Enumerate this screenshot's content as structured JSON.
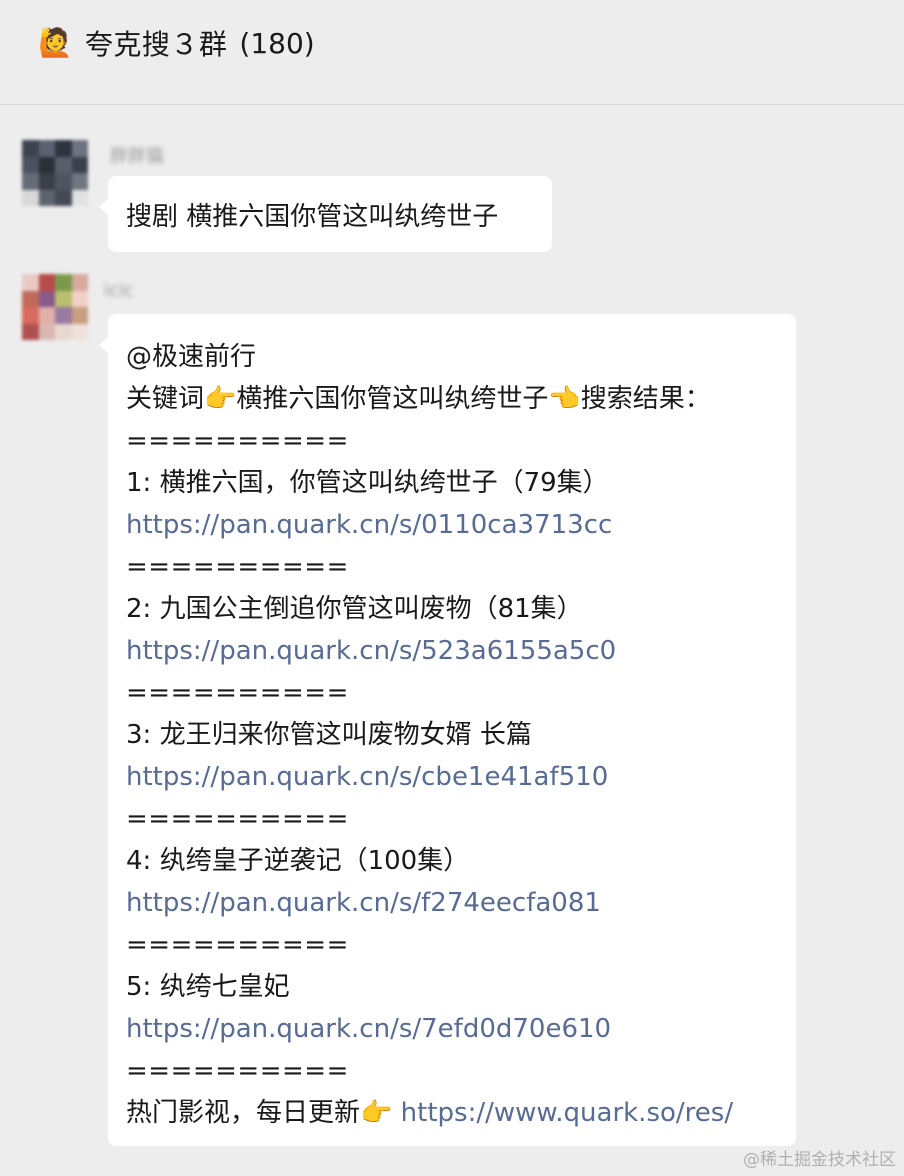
{
  "header": {
    "emoji": "🙋",
    "group_name": "夸克搜３群",
    "member_count": "(180)"
  },
  "messages": [
    {
      "sender": "胖胖猫",
      "text": "搜剧 横推六国你管这叫纨绔世子"
    },
    {
      "sender": "icic",
      "mention": "@极速前行",
      "keyword_prefix": "关键词",
      "keyword_emoji_left": "👉",
      "keyword": "横推六国你管这叫纨绔世子",
      "keyword_emoji_right": "👈",
      "keyword_suffix": "搜索结果：",
      "separator": "==========",
      "results": [
        {
          "title": "1: 横推六国，你管这叫纨绔世子（79集）",
          "url": "https://pan.quark.cn/s/0110ca3713cc"
        },
        {
          "title": "2: 九国公主倒追你管这叫废物（81集）",
          "url": "https://pan.quark.cn/s/523a6155a5c0"
        },
        {
          "title": "3: 龙王归来你管这叫废物女婿 长篇",
          "url": "https://pan.quark.cn/s/cbe1e41af510"
        },
        {
          "title": "4: 纨绔皇子逆袭记（100集）",
          "url": "https://pan.quark.cn/s/f274eecfa081"
        },
        {
          "title": "5: 纨绔七皇妃",
          "url": "https://pan.quark.cn/s/7efd0d70e610"
        }
      ],
      "footer_text": "热门影视，每日更新",
      "footer_emoji": "👉",
      "footer_url": "https://www.quark.so/res/"
    }
  ],
  "watermark": "@稀土掘金技术社区",
  "colors": {
    "background": "#ededed",
    "bubble": "#ffffff",
    "link": "#576b95"
  }
}
